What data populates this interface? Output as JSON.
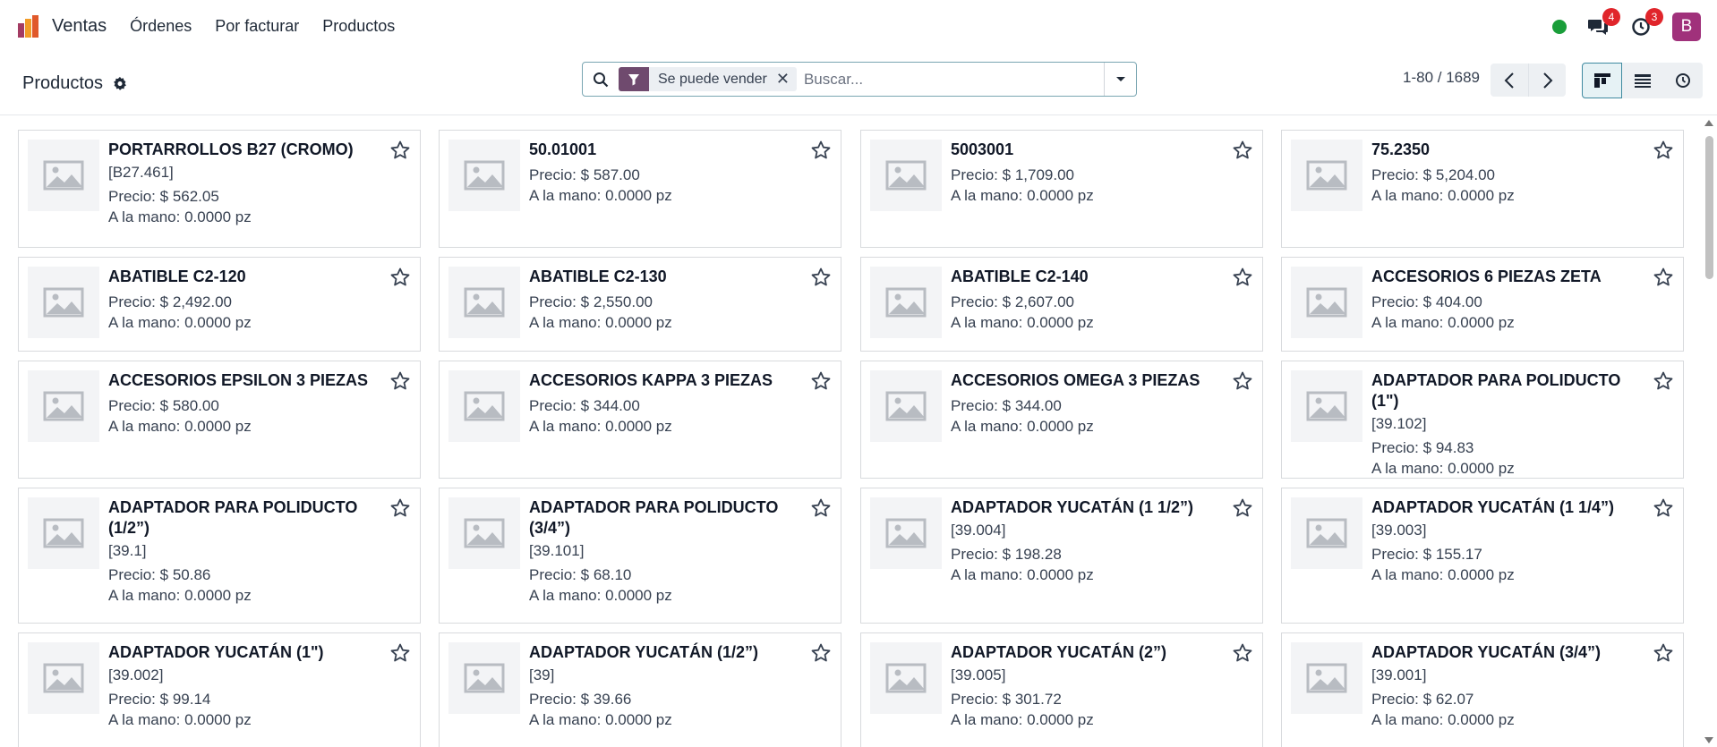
{
  "navbar": {
    "app_name": "Ventas",
    "menu": [
      "Órdenes",
      "Por facturar",
      "Productos"
    ],
    "messages_count": "4",
    "activities_count": "3",
    "avatar_letter": "B",
    "status_color": "#1a9e3a"
  },
  "control": {
    "title": "Productos",
    "facet_label": "Se puede vender",
    "search_placeholder": "Buscar...",
    "pager": "1-80 / 1689"
  },
  "labels": {
    "price_prefix": "Precio: ",
    "onhand_prefix": "A la mano: "
  },
  "products": [
    {
      "name": "PORTARROLLOS B27 (CROMO)",
      "ref": "[B27.461]",
      "price": "$ 562.05",
      "onhand": "0.0000 pz"
    },
    {
      "name": "50.01001",
      "ref": "",
      "price": "$ 587.00",
      "onhand": "0.0000 pz"
    },
    {
      "name": "5003001",
      "ref": "",
      "price": "$ 1,709.00",
      "onhand": "0.0000 pz"
    },
    {
      "name": "75.2350",
      "ref": "",
      "price": "$ 5,204.00",
      "onhand": "0.0000 pz"
    },
    {
      "name": "ABATIBLE C2-120",
      "ref": "",
      "price": "$ 2,492.00",
      "onhand": "0.0000 pz"
    },
    {
      "name": "ABATIBLE C2-130",
      "ref": "",
      "price": "$ 2,550.00",
      "onhand": "0.0000 pz"
    },
    {
      "name": "ABATIBLE C2-140",
      "ref": "",
      "price": "$ 2,607.00",
      "onhand": "0.0000 pz"
    },
    {
      "name": "ACCESORIOS 6 PIEZAS ZETA",
      "ref": "",
      "price": "$ 404.00",
      "onhand": "0.0000 pz"
    },
    {
      "name": "ACCESORIOS EPSILON 3 PIEZAS",
      "ref": "",
      "price": "$ 580.00",
      "onhand": "0.0000 pz"
    },
    {
      "name": "ACCESORIOS KAPPA 3 PIEZAS",
      "ref": "",
      "price": "$ 344.00",
      "onhand": "0.0000 pz"
    },
    {
      "name": "ACCESORIOS OMEGA 3 PIEZAS",
      "ref": "",
      "price": "$ 344.00",
      "onhand": "0.0000 pz"
    },
    {
      "name": "ADAPTADOR PARA POLIDUCTO (1\")",
      "ref": "[39.102]",
      "price": "$ 94.83",
      "onhand": "0.0000 pz"
    },
    {
      "name": "ADAPTADOR PARA POLIDUCTO (1/2”)",
      "ref": "[39.1]",
      "price": "$ 50.86",
      "onhand": "0.0000 pz"
    },
    {
      "name": "ADAPTADOR PARA POLIDUCTO (3/4”)",
      "ref": "[39.101]",
      "price": "$ 68.10",
      "onhand": "0.0000 pz"
    },
    {
      "name": "ADAPTADOR YUCATÁN (1 1/2”)",
      "ref": "[39.004]",
      "price": "$ 198.28",
      "onhand": "0.0000 pz"
    },
    {
      "name": "ADAPTADOR YUCATÁN (1 1/4”)",
      "ref": "[39.003]",
      "price": "$ 155.17",
      "onhand": "0.0000 pz"
    },
    {
      "name": "ADAPTADOR YUCATÁN (1\")",
      "ref": "[39.002]",
      "price": "$ 99.14",
      "onhand": "0.0000 pz"
    },
    {
      "name": "ADAPTADOR YUCATÁN (1/2”)",
      "ref": "[39]",
      "price": "$ 39.66",
      "onhand": "0.0000 pz"
    },
    {
      "name": "ADAPTADOR YUCATÁN (2”)",
      "ref": "[39.005]",
      "price": "$ 301.72",
      "onhand": "0.0000 pz"
    },
    {
      "name": "ADAPTADOR YUCATÁN (3/4”)",
      "ref": "[39.001]",
      "price": "$ 62.07",
      "onhand": "0.0000 pz"
    }
  ]
}
